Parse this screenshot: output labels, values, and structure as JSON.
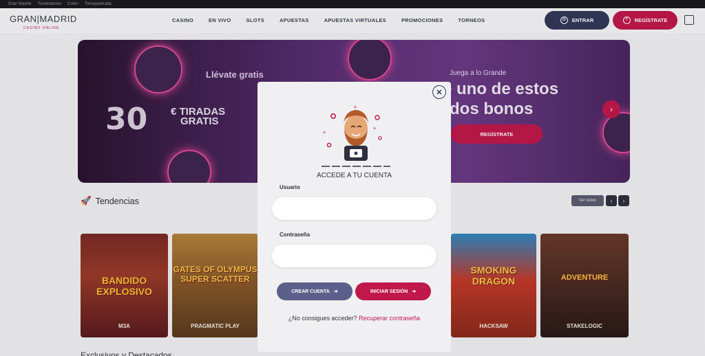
{
  "topbar": {
    "links": [
      "Gran Madrid",
      "Torrelodones",
      "Colón",
      "Torrequebrada"
    ]
  },
  "header": {
    "logo_main": "GRAN|MADRID",
    "logo_sub": "CASINO ONLINE",
    "nav": [
      "CASINO",
      "EN VIVO",
      "SLOTS",
      "APUESTAS",
      "APUESTAS VIRTUALES",
      "PROMOCIONES",
      "TORNEOS"
    ],
    "entrar_label": "ENTRAR",
    "registrate_label": "REGÍSTRATE"
  },
  "banner": {
    "left_heading": "Llévate gratis",
    "left_amount": "30",
    "left_currency": "€",
    "left_tiradas": "TIRADAS",
    "left_gratis": "GRATIS",
    "right_heading": "Juega a lo Grande",
    "right_title_1": "e uno de estos",
    "right_title_2": "dos bonos",
    "cta": "REGÍSTRATE"
  },
  "trends": {
    "title": "Tendencias",
    "ver_todos": "Ver todos",
    "games": [
      {
        "name": "BANDIDO EXPLOSIVO",
        "provider": "M3A"
      },
      {
        "name": "GATES OF OLYMPUS SUPER SCATTER",
        "provider": "PRAGMATIC PLAY"
      },
      {
        "name": "SMOKING DRAGON",
        "provider": "HACKSAW"
      },
      {
        "name": "ADVENTURE",
        "provider": "STAKELOGIC"
      }
    ]
  },
  "bottom_section": {
    "title": "Exclusivos y Destacados"
  },
  "modal": {
    "title": "ACCEDE A TU CUENTA",
    "usuario_label": "Usuario",
    "usuario_value": "",
    "contrasena_label": "Contraseña",
    "contrasena_value": "",
    "crear_label": "CREAR CUENTA",
    "iniciar_label": "INICIAR SESIÓN",
    "recover_text": "¿No consigues acceder?",
    "recover_link": "Recuperar contraseña"
  },
  "colors": {
    "brand": "#c0184a",
    "navy": "#33395a",
    "secondary": "#5c5f8a"
  }
}
